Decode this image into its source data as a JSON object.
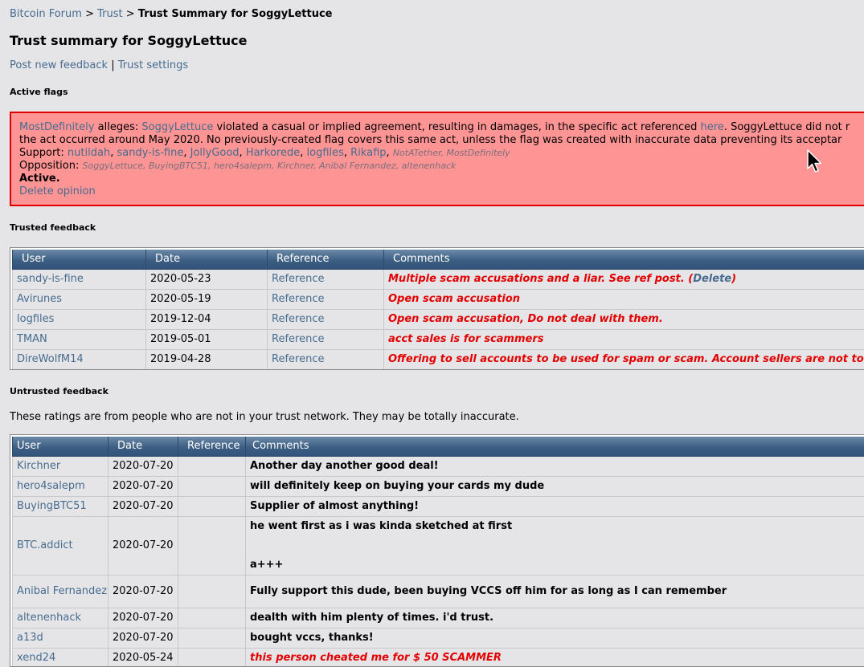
{
  "breadcrumb": {
    "forum": "Bitcoin Forum",
    "sep1": ">",
    "trust": "Trust",
    "sep2": ">",
    "current": "Trust Summary for SoggyLettuce"
  },
  "page_title": "Trust summary for SoggyLettuce",
  "links": {
    "post_feedback": "Post new feedback",
    "sep": "|",
    "trust_settings": "Trust settings"
  },
  "flags": {
    "heading": "Active flags",
    "flagger": "MostDefinitely",
    "alleges": "alleges:",
    "target": "SoggyLettuce",
    "text1": "violated a casual or implied agreement, resulting in damages, in the specific act referenced",
    "here": "here",
    "text2": ". SoggyLettuce did not r",
    "line2": "the act occurred around May 2020. No previously-created flag covers this same act, unless the flag was created with inaccurate data preventing its acceptar",
    "support_label": "Support:",
    "support": [
      "nutildah",
      "sandy-is-fine",
      "JollyGood",
      "Harkorede",
      "logfiles",
      "Rikafip"
    ],
    "support_untrusted": "NotATether, MostDefinitely",
    "opposition_label": "Opposition:",
    "opposition_untrusted": "SoggyLettuce, BuyingBTC51, hero4salepm, Kirchner, Anibal Fernandez, altenenhack",
    "status": "Active.",
    "delete": "Delete opinion"
  },
  "trusted": {
    "heading": "Trusted feedback",
    "columns": {
      "user": "User",
      "date": "Date",
      "reference": "Reference",
      "comments": "Comments"
    },
    "rows": [
      {
        "user": "sandy-is-fine",
        "date": "2020-05-23",
        "ref": "Reference",
        "comment": "Multiple scam accusations and a liar. See ref post.",
        "extra_open": " (",
        "extra_link": "Delete",
        "extra_close": ")"
      },
      {
        "user": "Avirunes",
        "date": "2020-05-19",
        "ref": "Reference",
        "comment": "Open scam accusation"
      },
      {
        "user": "logfiles",
        "date": "2019-12-04",
        "ref": "Reference",
        "comment": "Open scam accusation, Do not deal with them."
      },
      {
        "user": "TMAN",
        "date": "2019-05-01",
        "ref": "Reference",
        "comment": "acct sales is for scammers"
      },
      {
        "user": "DireWolfM14",
        "date": "2019-04-28",
        "ref": "Reference",
        "comment": "Offering to sell accounts to be used for spam or scam. Account sellers are not to be"
      }
    ]
  },
  "untrusted": {
    "heading": "Untrusted feedback",
    "note": "These ratings are from people who are not in your trust network. They may be totally inaccurate.",
    "columns": {
      "user": "User",
      "date": "Date",
      "reference": "Reference",
      "comments": "Comments"
    },
    "rows": [
      {
        "user": "Kirchner",
        "date": "2020-07-20",
        "ref": "",
        "comment": "Another day another good deal!"
      },
      {
        "user": "hero4salepm",
        "date": "2020-07-20",
        "ref": "",
        "comment": "will definitely keep on buying your cards my dude"
      },
      {
        "user": "BuyingBTC51",
        "date": "2020-07-20",
        "ref": "",
        "comment": "Supplier of almost anything!"
      },
      {
        "user": "BTC.addict",
        "date": "2020-07-20",
        "ref": "",
        "comment": "he went first as i was kinda sketched at first",
        "comment2": "a+++"
      },
      {
        "user": "Anibal Fernandez",
        "date": "2020-07-20",
        "ref": "",
        "comment": "Fully support this dude, been buying VCCS off him for as long as I can remember"
      },
      {
        "user": "altenenhack",
        "date": "2020-07-20",
        "ref": "",
        "comment": "dealth with him plenty of times. i'd trust."
      },
      {
        "user": "a13d",
        "date": "2020-07-20",
        "ref": "",
        "comment": "bought vccs, thanks!"
      },
      {
        "user": "xend24",
        "date": "2020-05-24",
        "ref": "",
        "comment": "this person cheated me for $ 50 SCAMMER"
      }
    ]
  },
  "colors": {
    "link": "#476c8e",
    "negative": "#e30000",
    "flag_bg": "#ff9494",
    "flag_border": "#e00000"
  },
  "icons": {
    "cursor": "mouse-pointer-icon"
  }
}
